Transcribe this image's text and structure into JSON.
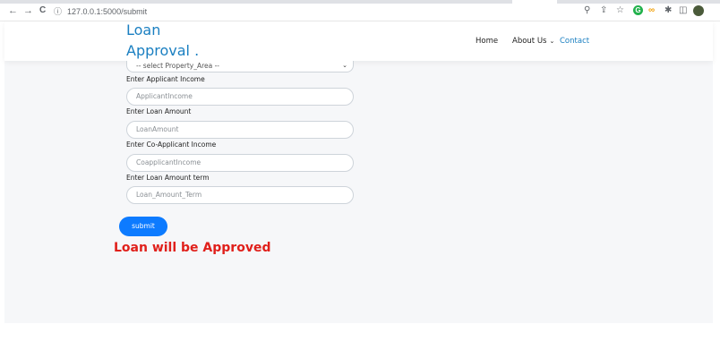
{
  "browser": {
    "url": "127.0.0.1:5000/submit",
    "back_icon": "←",
    "forward_icon": "→",
    "reload_icon": "C",
    "info_icon": "ⓘ",
    "zoom_icon": "⚲",
    "share_icon": "⇪",
    "star_icon": "☆",
    "ext_g_label": "G",
    "ext_link_label": "∞",
    "puzzle_icon": "✱",
    "sidepanel_icon": "◫"
  },
  "header": {
    "brand_line1": "Loan",
    "brand_line2": "Approval .",
    "nav_home": "Home",
    "nav_about": "About Us",
    "nav_about_caret": "⌄",
    "nav_contact": "Contact"
  },
  "form": {
    "property_area_select": "-- select Property_Area --",
    "select_chevron": "⌄",
    "applicant_income_label": "Enter Applicant Income",
    "applicant_income_placeholder": "ApplicantIncome",
    "loan_amount_label": "Enter Loan Amount",
    "loan_amount_placeholder": "LoanAmount",
    "coapplicant_income_label": "Enter Co-Applicant Income",
    "coapplicant_income_placeholder": "CoapplicantIncome",
    "loan_term_label": "Enter Loan Amount term",
    "loan_term_placeholder": "Loan_Amount_Term",
    "submit_label": "submit"
  },
  "result": {
    "message": "Loan will be Approved"
  },
  "colors": {
    "brand": "#1a7fc1",
    "submit_button": "#0d7bff",
    "result_text": "#e0201b",
    "page_background": "#f6f7f9"
  }
}
